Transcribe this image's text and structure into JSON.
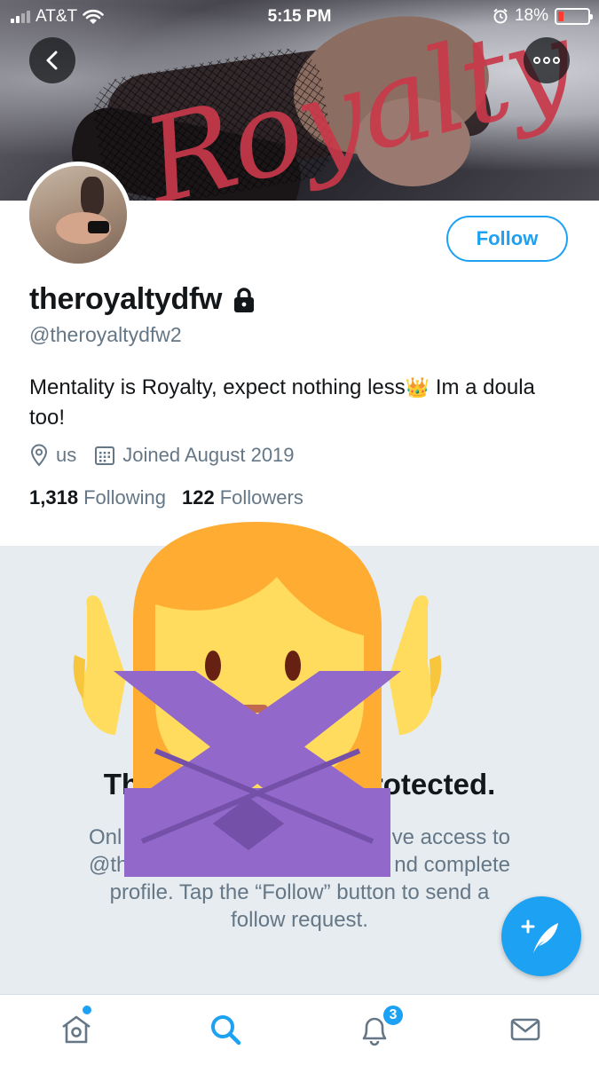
{
  "status_bar": {
    "carrier": "AT&T",
    "time": "5:15 PM",
    "battery": "18%",
    "battery_level": 0.18,
    "battery_color": "#ff3b30"
  },
  "header": {
    "banner_text": "Royalty",
    "back_icon": "chevron-left-icon",
    "more_icon": "more-options-icon"
  },
  "profile": {
    "display_name": "theroyaltydfw",
    "handle": "@theroyaltydfw2",
    "bio": "Mentality is Royalty, expect nothing less",
    "bio_emoji": "👑",
    "bio_tail": " Im a doula too!",
    "location": "us",
    "joined": "Joined August 2019",
    "following_count": "1,318",
    "following_label": "Following",
    "followers_count": "122",
    "followers_label": "Followers",
    "follow_button": "Follow"
  },
  "protected": {
    "title": "These Tweets are protected.",
    "title_visible_left": "Thes",
    "title_visible_right": "protected.",
    "body_line1_left": "Onl",
    "body_line1_right": "ve access to",
    "body_line2_left": "@th",
    "body_line2_right": "nd complete",
    "body_line3": "profile. Tap the “Follow” button to send a",
    "body_line4": "follow request."
  },
  "tabbar": {
    "home_icon": "home-icon",
    "search_icon": "search-icon",
    "notifications_icon": "bell-icon",
    "notifications_count": "3",
    "messages_icon": "mail-icon"
  },
  "colors": {
    "accent": "#1da1f2",
    "text_secondary": "#657786",
    "protected_bg": "#e6ecf0"
  }
}
